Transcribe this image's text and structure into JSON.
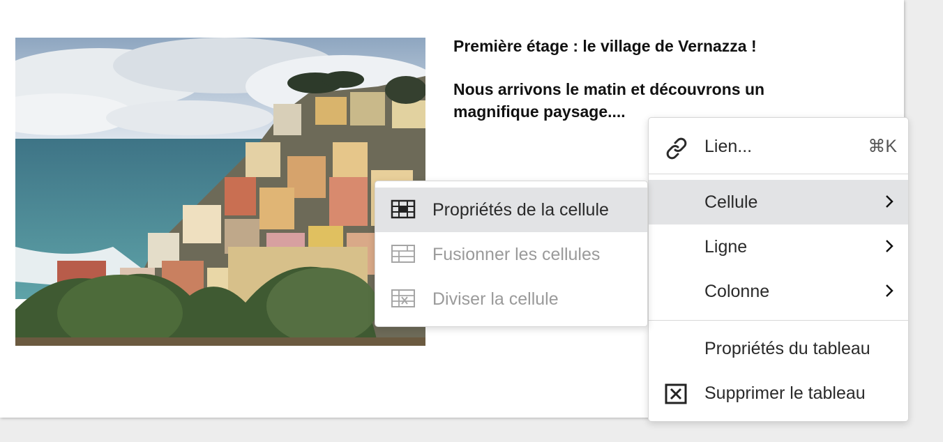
{
  "document": {
    "heading": "Première étage : le village de Vernazza !",
    "paragraph": "Nous arrivons le matin et découvrons un magnifique paysage...."
  },
  "context_menu": {
    "link": {
      "label": "Lien...",
      "shortcut": "⌘K",
      "icon": "link-icon"
    },
    "cell": {
      "label": "Cellule"
    },
    "row": {
      "label": "Ligne"
    },
    "column": {
      "label": "Colonne"
    },
    "table_properties": {
      "label": "Propriétés du tableau"
    },
    "delete_table": {
      "label": "Supprimer le tableau",
      "icon": "delete-table-icon"
    }
  },
  "cell_submenu": {
    "properties": {
      "label": "Propriétés de la cellule",
      "icon": "cell-properties-icon"
    },
    "merge": {
      "label": "Fusionner les cellules",
      "icon": "merge-cells-icon",
      "disabled": true
    },
    "split": {
      "label": "Diviser la cellule",
      "icon": "split-cell-icon",
      "disabled": true
    }
  },
  "colors": {
    "active_item_bg": "#e2e3e5",
    "disabled_text": "#9a9a9a"
  }
}
